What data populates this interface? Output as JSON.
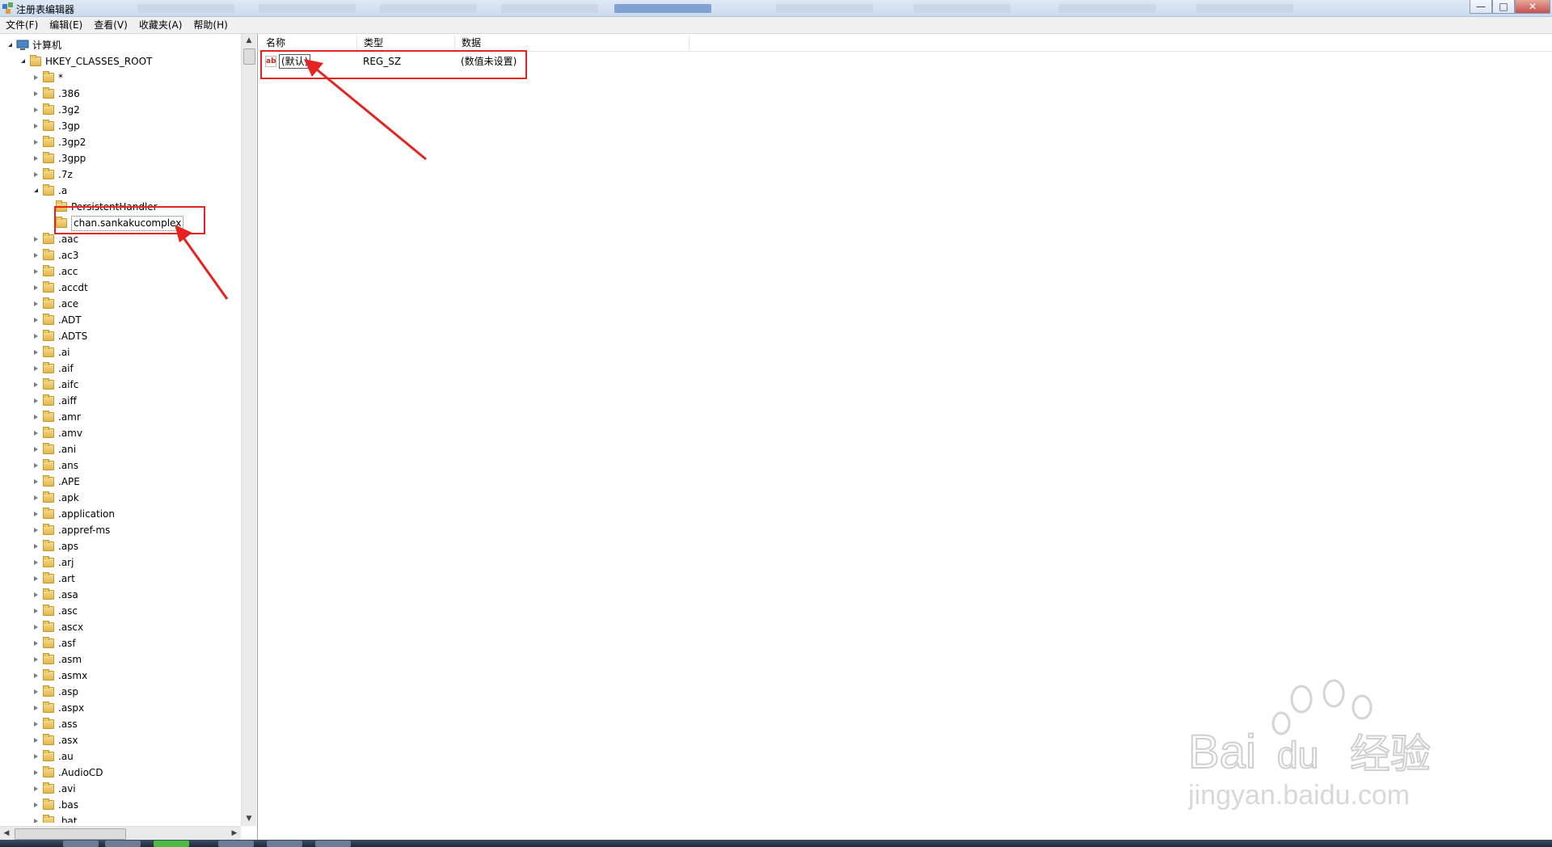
{
  "window": {
    "title": "注册表编辑器",
    "controls": {
      "minimize": "—",
      "maximize": "□",
      "close": "✕"
    }
  },
  "menu": [
    "文件(F)",
    "编辑(E)",
    "查看(V)",
    "收藏夹(A)",
    "帮助(H)"
  ],
  "tree": {
    "root": "计算机",
    "hive": "HKEY_CLASSES_ROOT",
    "keys_before": [
      "*",
      ".386",
      ".3g2",
      ".3gp",
      ".3gp2",
      ".3gpp",
      ".7z"
    ],
    "expanded_key": ".a",
    "expanded_children": [
      "PersistentHandler",
      "chan.sankakucomplex"
    ],
    "selected": "chan.sankakucomplex",
    "keys_after": [
      ".aac",
      ".ac3",
      ".acc",
      ".accdt",
      ".ace",
      ".ADT",
      ".ADTS",
      ".ai",
      ".aif",
      ".aifc",
      ".aiff",
      ".amr",
      ".amv",
      ".ani",
      ".ans",
      ".APE",
      ".apk",
      ".application",
      ".appref-ms",
      ".aps",
      ".arj",
      ".art",
      ".asa",
      ".asc",
      ".ascx",
      ".asf",
      ".asm",
      ".asmx",
      ".asp",
      ".aspx",
      ".ass",
      ".asx",
      ".au",
      ".AudioCD",
      ".avi",
      ".bas",
      ".bat"
    ]
  },
  "list": {
    "columns": [
      "名称",
      "类型",
      "数据"
    ],
    "rows": [
      {
        "name": "(默认)",
        "type": "REG_SZ",
        "data": "(数值未设置)",
        "icon": "ab"
      }
    ]
  },
  "watermark": {
    "brand": "Bai",
    "brand2": "du",
    "cn": "经验",
    "url": "jingyan.baidu.com"
  },
  "colors": {
    "highlight": "#e52422",
    "selection_folder": "#e3b64a"
  }
}
